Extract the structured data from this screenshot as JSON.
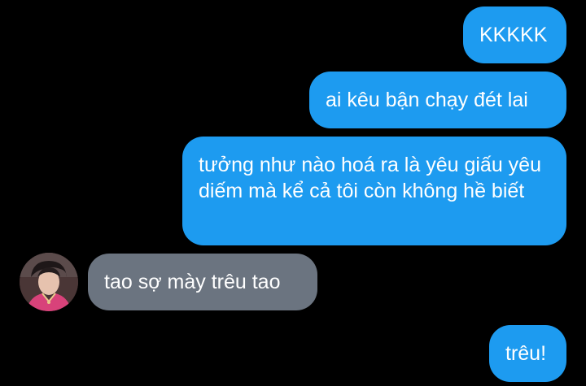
{
  "conversation": {
    "messages": [
      {
        "sender": "me",
        "text": "KKKKK"
      },
      {
        "sender": "me",
        "text": "ai kêu bận chạy đét lai"
      },
      {
        "sender": "me",
        "text": "tưởng như nào hoá ra là yêu giấu yêu diếm mà kể cả tôi còn không hề biết"
      },
      {
        "sender": "other",
        "text": "tao sợ mày trêu tao"
      },
      {
        "sender": "me",
        "text": "trêu!"
      }
    ]
  },
  "colors": {
    "background": "#000000",
    "outgoing_bubble": "#1d9bf0",
    "incoming_bubble": "#6b7480",
    "text": "#ffffff"
  },
  "icons": {
    "avatar": "user-avatar-photo"
  }
}
